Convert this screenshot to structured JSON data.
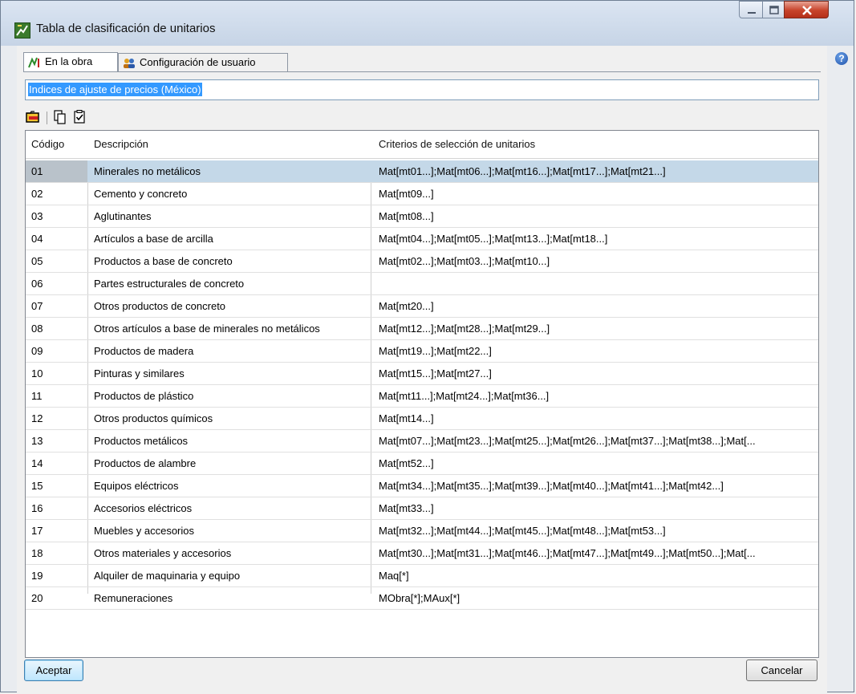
{
  "window": {
    "title": "Tabla de clasificación de unitarios"
  },
  "tabs": [
    {
      "label": "En la obra",
      "icon": "chart-icon",
      "active": true
    },
    {
      "label": "Configuración de usuario",
      "icon": "users-icon",
      "active": false
    }
  ],
  "name_field": {
    "value": "Indices de ajuste de precios (México)"
  },
  "toolbar": {
    "icons": [
      "open-folder-icon",
      "copy-icon",
      "checklist-icon"
    ]
  },
  "grid": {
    "columns": [
      "Código",
      "Descripción",
      "Criterios de selección de unitarios"
    ],
    "rows": [
      {
        "code": "01",
        "desc": "Minerales no metálicos",
        "crit": "Mat[mt01...];Mat[mt06...];Mat[mt16...];Mat[mt17...];Mat[mt21...]"
      },
      {
        "code": "02",
        "desc": "Cemento y concreto",
        "crit": "Mat[mt09...]"
      },
      {
        "code": "03",
        "desc": "Aglutinantes",
        "crit": "Mat[mt08...]"
      },
      {
        "code": "04",
        "desc": "Artículos a base de arcilla",
        "crit": "Mat[mt04...];Mat[mt05...];Mat[mt13...];Mat[mt18...]"
      },
      {
        "code": "05",
        "desc": "Productos a base de concreto",
        "crit": "Mat[mt02...];Mat[mt03...];Mat[mt10...]"
      },
      {
        "code": "06",
        "desc": "Partes estructurales de concreto",
        "crit": ""
      },
      {
        "code": "07",
        "desc": "Otros productos de concreto",
        "crit": "Mat[mt20...]"
      },
      {
        "code": "08",
        "desc": "Otros artículos a base de minerales no metálicos",
        "crit": "Mat[mt12...];Mat[mt28...];Mat[mt29...]"
      },
      {
        "code": "09",
        "desc": "Productos de madera",
        "crit": "Mat[mt19...];Mat[mt22...]"
      },
      {
        "code": "10",
        "desc": "Pinturas y similares",
        "crit": "Mat[mt15...];Mat[mt27...]"
      },
      {
        "code": "11",
        "desc": "Productos de plástico",
        "crit": "Mat[mt11...];Mat[mt24...];Mat[mt36...]"
      },
      {
        "code": "12",
        "desc": "Otros productos químicos",
        "crit": "Mat[mt14...]"
      },
      {
        "code": "13",
        "desc": "Productos metálicos",
        "crit": "Mat[mt07...];Mat[mt23...];Mat[mt25...];Mat[mt26...];Mat[mt37...];Mat[mt38...];Mat[..."
      },
      {
        "code": "14",
        "desc": "Productos de alambre",
        "crit": "Mat[mt52...]"
      },
      {
        "code": "15",
        "desc": "Equipos eléctricos",
        "crit": "Mat[mt34...];Mat[mt35...];Mat[mt39...];Mat[mt40...];Mat[mt41...];Mat[mt42...]"
      },
      {
        "code": "16",
        "desc": "Accesorios eléctricos",
        "crit": "Mat[mt33...]"
      },
      {
        "code": "17",
        "desc": "Muebles y accesorios",
        "crit": "Mat[mt32...];Mat[mt44...];Mat[mt45...];Mat[mt48...];Mat[mt53...]"
      },
      {
        "code": "18",
        "desc": "Otros materiales y accesorios",
        "crit": "Mat[mt30...];Mat[mt31...];Mat[mt46...];Mat[mt47...];Mat[mt49...];Mat[mt50...];Mat[..."
      },
      {
        "code": "19",
        "desc": "Alquiler de maquinaria y equipo",
        "crit": "Maq[*]"
      },
      {
        "code": "20",
        "desc": "Remuneraciones",
        "crit": "MObra[*];MAux[*]"
      }
    ],
    "selected_row": 0
  },
  "buttons": {
    "ok": "Aceptar",
    "cancel": "Cancelar"
  },
  "colors": {
    "selection": "#c4d8e8",
    "field_highlight": "#3399ff"
  }
}
